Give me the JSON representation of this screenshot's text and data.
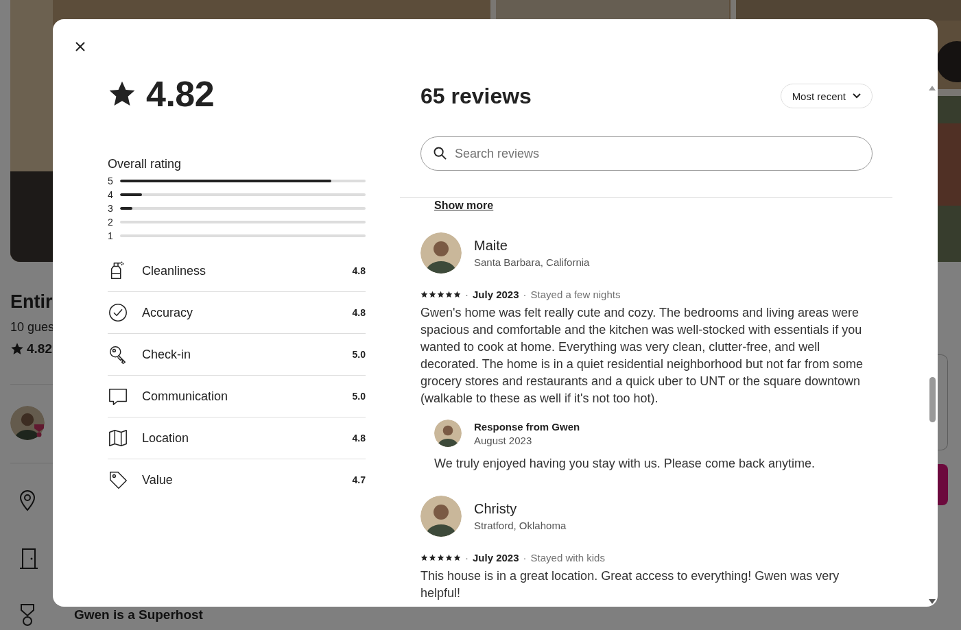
{
  "background": {
    "listing_title": "Entir",
    "guests": "10 gues",
    "rating": "4.82",
    "host_note": "Gwen is a Superhost"
  },
  "modal": {
    "rating": "4.82",
    "overall_label": "Overall rating",
    "distribution": [
      {
        "label": "5",
        "level": 0.86
      },
      {
        "label": "4",
        "level": 0.09
      },
      {
        "label": "3",
        "level": 0.05
      },
      {
        "label": "2",
        "level": 0
      },
      {
        "label": "1",
        "level": 0
      }
    ],
    "categories": [
      {
        "name": "Cleanliness",
        "score": "4.8"
      },
      {
        "name": "Accuracy",
        "score": "4.8"
      },
      {
        "name": "Check-in",
        "score": "5.0"
      },
      {
        "name": "Communication",
        "score": "5.0"
      },
      {
        "name": "Location",
        "score": "4.8"
      },
      {
        "name": "Value",
        "score": "4.7"
      }
    ],
    "reviews_title": "65 reviews",
    "sort": "Most recent",
    "search": {
      "placeholder": "Search reviews"
    },
    "show_more": "Show more",
    "reviews": [
      {
        "name": "Maite",
        "location": "Santa Barbara, California",
        "stars": 5,
        "date": "July 2023",
        "stay": "Stayed a few nights",
        "separators": [
          "·",
          "·"
        ],
        "text": "Gwen's home was felt really cute and cozy. The bedrooms and living areas were spacious and comfortable and the kitchen was well-stocked with essentials if you wanted to cook at home. Everything was very clean, clutter-free, and well decorated. The home is in a quiet residential neighborhood but not far from some grocery stores and restaurants and a quick uber to UNT or the square downtown (walkable to these as well if it's not too hot).",
        "response": {
          "title": "Response from Gwen",
          "date": "August 2023",
          "text": "We truly enjoyed having you stay with us. Please come back anytime."
        }
      },
      {
        "name": "Christy",
        "location": "Stratford, Oklahoma",
        "stars": 5,
        "date": "July 2023",
        "stay": "Stayed with kids",
        "separators": [
          "·",
          "·"
        ],
        "text": "This house is in a great location. Great access to everything! Gwen was very helpful!"
      }
    ]
  }
}
